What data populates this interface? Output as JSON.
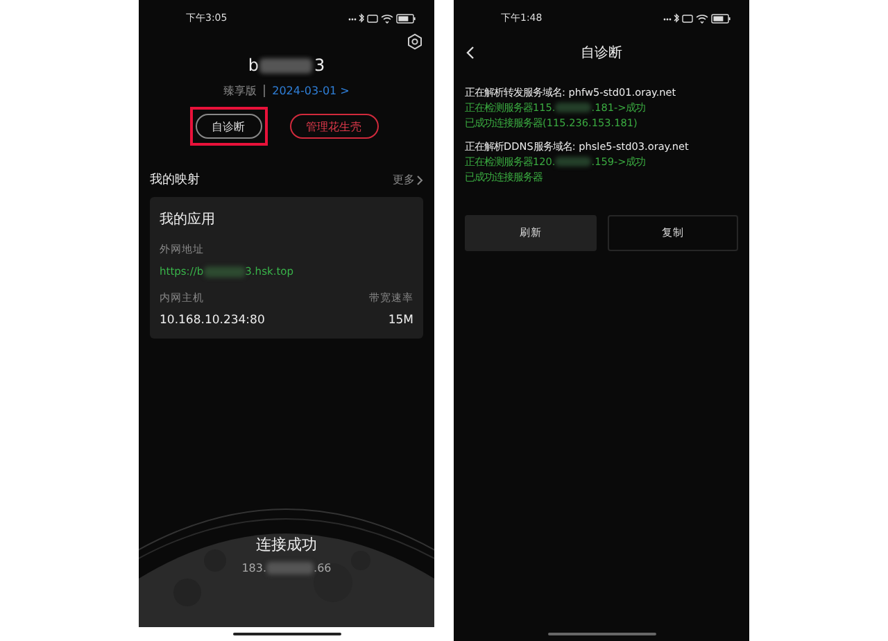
{
  "home_screen": {
    "status_bar": {
      "time": "下午3:05"
    },
    "device_name": [
      "b",
      "3"
    ],
    "edition": "臻享版",
    "expiry": "2024-03-01 >",
    "buttons": [
      {
        "label": "自诊断",
        "kind": "outline",
        "highlighted": true
      },
      {
        "label": "管理花生壳",
        "kind": "danger",
        "highlighted": false
      }
    ],
    "mappings": {
      "title": "我的映射",
      "more": "更多",
      "card": {
        "title": "我的应用",
        "public_label": "外网地址",
        "url": [
          "https://b",
          "3.hsk.top"
        ],
        "host_label": "内网主机",
        "bandwidth_label": "带宽速率",
        "host": "10.168.10.234:80",
        "bandwidth": "15M"
      }
    },
    "connection": {
      "status": "连接成功",
      "ip": [
        "183.",
        ".66"
      ]
    }
  },
  "diagnosis_screen": {
    "status_bar": {
      "time": "下午1:48"
    },
    "title": "自诊断",
    "sections": [
      {
        "lines": [
          {
            "kind": "info",
            "parts": [
              "正在解析转发服务域名: phfw5-std01.oray.net"
            ]
          },
          {
            "kind": "success",
            "parts": [
              "正在检测服务器115.",
              ".181->成功"
            ]
          },
          {
            "kind": "success",
            "parts": [
              "已成功连接服务器(115.236.153.181)"
            ]
          }
        ]
      },
      {
        "lines": [
          {
            "kind": "info",
            "parts": [
              "正在解析DDNS服务域名: phsle5-std03.oray.net"
            ]
          },
          {
            "kind": "success",
            "parts": [
              "正在检测服务器120.",
              ".159->成功"
            ]
          },
          {
            "kind": "success",
            "parts": [
              "已成功连接服务器"
            ]
          }
        ]
      }
    ],
    "buttons": [
      {
        "label": "刷新",
        "kind": "filled"
      },
      {
        "label": "复制",
        "kind": "outline"
      }
    ]
  }
}
